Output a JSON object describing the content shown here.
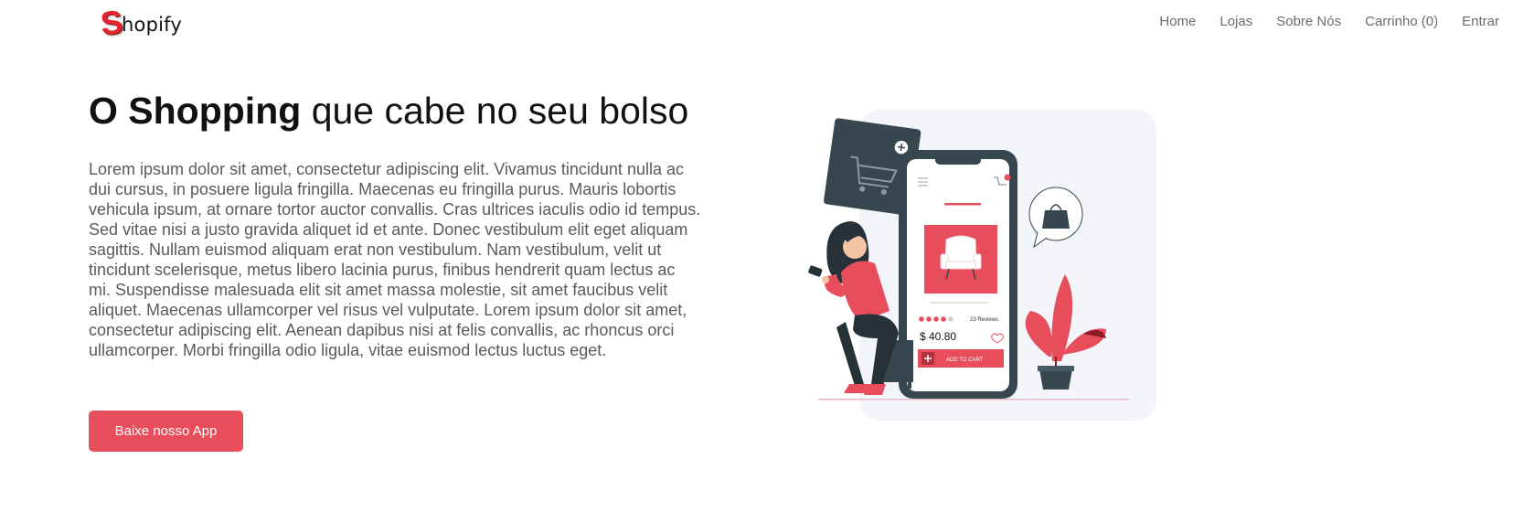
{
  "navbar": {
    "brand": {
      "initial": "S",
      "text": "hopify"
    },
    "links": [
      {
        "label": "Home"
      },
      {
        "label": "Lojas"
      },
      {
        "label": "Sobre Nós"
      },
      {
        "label": "Carrinho (0)"
      },
      {
        "label": "Entrar"
      }
    ]
  },
  "hero": {
    "title_bold": "O Shopping",
    "title_rest": " que cabe no seu bolso",
    "paragraph": "Lorem ipsum dolor sit amet, consectetur adipiscing elit. Vivamus tincidunt nulla ac dui cursus, in posuere ligula fringilla. Maecenas eu fringilla purus. Mauris lobortis vehicula ipsum, at ornare tortor auctor convallis. Cras ultrices iaculis odio id tempus. Sed vitae nisi a justo gravida aliquet id et ante. Donec vestibulum elit eget aliquam sagittis. Nullam euismod aliquam erat non vestibulum. Nam vestibulum, velit ut tincidunt scelerisque, metus libero lacinia purus, finibus hendrerit quam lectus ac mi. Suspendisse malesuada elit sit amet massa molestie, sit amet faucibus velit aliquet. Maecenas ullamcorper vel risus vel vulputate. Lorem ipsum dolor sit amet, consectetur adipiscing elit. Aenean dapibus nisi at felis convallis, ac rhoncus orci ullamcorper. Morbi fringilla odio ligula, vitae euismod lectus luctus eget.",
    "cta_label": "Baixe nosso App"
  },
  "illustration": {
    "reviews": "23 Reviews",
    "price": "$ 40.80",
    "add_to_cart": "ADD TO CART",
    "rating": 4,
    "rating_max": 5
  },
  "colors": {
    "accent": "#e84d5b",
    "brand_red": "#e3262f",
    "dark": "#37474f",
    "panel_bg": "#f4f5fa"
  }
}
